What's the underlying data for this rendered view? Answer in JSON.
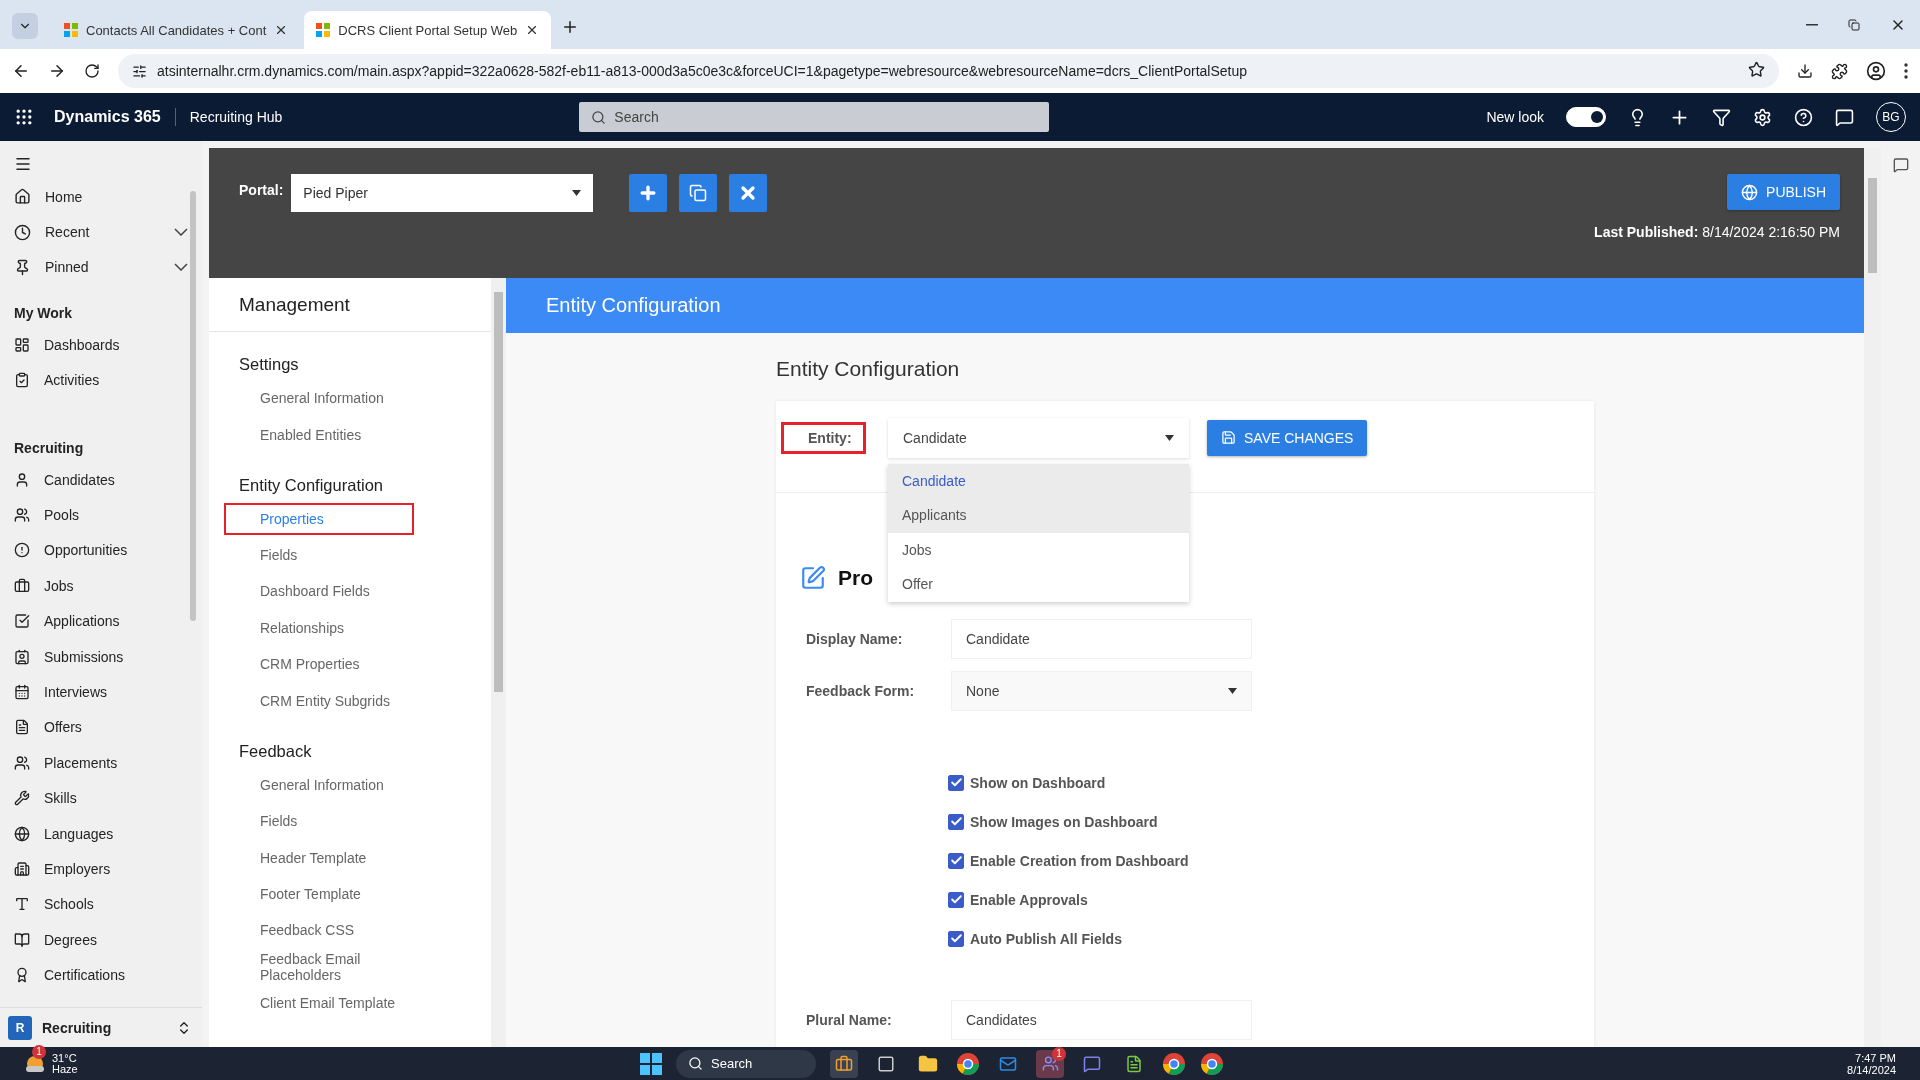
{
  "browser": {
    "tabs": [
      {
        "title": "Contacts All Candidates + Cont",
        "selected": false
      },
      {
        "title": "DCRS Client Portal Setup Web",
        "selected": true
      }
    ],
    "url": "atsinternalhr.crm.dynamics.com/main.aspx?appid=322a0628-582f-eb11-a813-000d3a5c0e3c&forceUCI=1&pagetype=webresource&webresourceName=dcrs_ClientPortalSetup"
  },
  "app_bar": {
    "brand": "Dynamics 365",
    "area": "Recruiting Hub",
    "search_placeholder": "Search",
    "new_look": {
      "label": "New look",
      "on": true
    },
    "avatar": "BG"
  },
  "nav": {
    "top": [
      {
        "label": "Home"
      },
      {
        "label": "Recent",
        "expanded": false
      },
      {
        "label": "Pinned",
        "expanded": false
      }
    ],
    "sections": [
      {
        "heading": "My Work",
        "items": [
          {
            "label": "Dashboards"
          },
          {
            "label": "Activities"
          }
        ]
      },
      {
        "heading": "Recruiting",
        "items": [
          {
            "label": "Candidates"
          },
          {
            "label": "Pools"
          },
          {
            "label": "Opportunities"
          },
          {
            "label": "Jobs"
          },
          {
            "label": "Applications"
          },
          {
            "label": "Submissions"
          },
          {
            "label": "Interviews"
          },
          {
            "label": "Offers"
          },
          {
            "label": "Placements"
          },
          {
            "label": "Skills"
          },
          {
            "label": "Languages"
          },
          {
            "label": "Employers"
          },
          {
            "label": "Schools"
          },
          {
            "label": "Degrees"
          },
          {
            "label": "Certifications"
          }
        ]
      }
    ],
    "area_switcher": {
      "badge": "R",
      "label": "Recruiting"
    }
  },
  "portal": {
    "label": "Portal:",
    "value": "Pied Piper",
    "publish": "PUBLISH",
    "last_published_label": "Last Published:",
    "last_published": "8/14/2024 2:16:50 PM"
  },
  "management": {
    "title": "Management",
    "groups": [
      {
        "heading": "Settings",
        "items": [
          {
            "label": "General Information",
            "selected": false
          },
          {
            "label": "Enabled Entities",
            "selected": false
          }
        ]
      },
      {
        "heading": "Entity Configuration",
        "items": [
          {
            "label": "Properties",
            "selected": true
          },
          {
            "label": "Fields",
            "selected": false
          },
          {
            "label": "Dashboard Fields",
            "selected": false
          },
          {
            "label": "Relationships",
            "selected": false
          },
          {
            "label": "CRM Properties",
            "selected": false
          },
          {
            "label": "CRM Entity Subgrids",
            "selected": false
          }
        ]
      },
      {
        "heading": "Feedback",
        "items": [
          {
            "label": "General Information",
            "selected": false
          },
          {
            "label": "Fields",
            "selected": false
          },
          {
            "label": "Header Template",
            "selected": false
          },
          {
            "label": "Footer Template",
            "selected": false
          },
          {
            "label": "Feedback CSS",
            "selected": false
          },
          {
            "label": "Feedback Email Placeholders",
            "selected": false
          },
          {
            "label": "Client Email Template",
            "selected": false
          }
        ]
      }
    ]
  },
  "page": {
    "banner": "Entity Configuration",
    "heading": "Entity Configuration",
    "entity": {
      "label": "Entity:",
      "highlighted": true,
      "value": "Candidate",
      "expanded": true,
      "options": [
        {
          "label": "Candidate",
          "selected": true,
          "hovered": false
        },
        {
          "label": "Applicants",
          "selected": false,
          "hovered": true
        },
        {
          "label": "Jobs",
          "selected": false,
          "hovered": false
        },
        {
          "label": "Offer",
          "selected": false,
          "hovered": false
        }
      ]
    },
    "save": "SAVE CHANGES",
    "section_title": "Pro",
    "fields": [
      {
        "label": "Display Name:",
        "value": "Candidate",
        "kind": "text"
      },
      {
        "label": "Feedback Form:",
        "value": "None",
        "kind": "select"
      }
    ],
    "checkboxes": [
      {
        "label": "Show on Dashboard",
        "checked": true
      },
      {
        "label": "Show Images on Dashboard",
        "checked": true
      },
      {
        "label": "Enable Creation from Dashboard",
        "checked": true
      },
      {
        "label": "Enable Approvals",
        "checked": true
      },
      {
        "label": "Auto Publish All Fields",
        "checked": true
      }
    ],
    "bottom_fields": [
      {
        "label": "Plural Name:",
        "value": "Candidates",
        "kind": "text"
      }
    ]
  },
  "taskbar": {
    "weather_badge": "1",
    "temperature": "31°C",
    "condition": "Haze",
    "search": "Search",
    "teams_badge": "1",
    "time": "7:47 PM",
    "date": "8/14/2024"
  }
}
